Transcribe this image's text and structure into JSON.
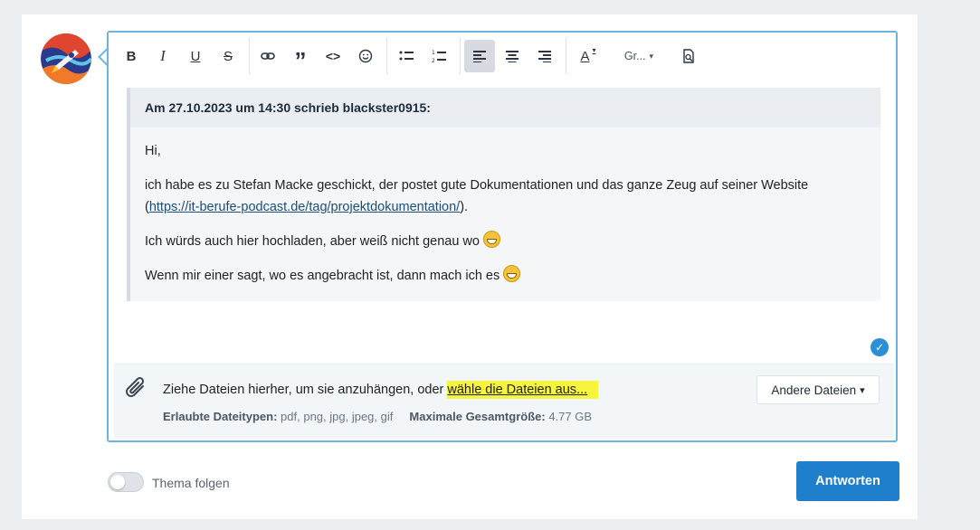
{
  "toolbar": {
    "bold": "B",
    "italic": "I",
    "underline": "U",
    "strike": "S",
    "quote": "”",
    "code": "<>",
    "font_size_label": "Gr...",
    "font_size_caret": "▾",
    "text_color": "A"
  },
  "quote": {
    "header": "Am 27.10.2023 um 14:30 schrieb blackster0915:",
    "greeting": "Hi,",
    "line1": "ich habe es zu Stefan Macke geschickt, der postet gute Dokumentationen und das ganze Zeug auf seiner Website",
    "link_open": "(",
    "link": "https://it-berufe-podcast.de/tag/projektdokumentation/",
    "link_close": ").",
    "line3": "Ich würds auch hier hochladen, aber weiß nicht genau wo",
    "line4": "Wenn mir einer sagt, wo es angebracht ist, dann mach ich es"
  },
  "attachments": {
    "drop_text": "Ziehe Dateien hierher, um sie anzuhängen, oder ",
    "choose_link": "wähle die Dateien aus...",
    "allowed_label": "Erlaubte Dateitypen:",
    "allowed_value": "pdf, png, jpg, jpeg, gif",
    "max_label": "Maximale Gesamtgröße:",
    "max_value": "4.77 GB",
    "other_files": "Andere Dateien",
    "other_caret": "▾"
  },
  "footer": {
    "follow_label": "Thema folgen",
    "follow_on": false,
    "reply_button": "Antworten"
  },
  "colors": {
    "accent": "#1f7fcc",
    "editor_border": "#6fb3dd",
    "highlight": "#f7f53b"
  }
}
